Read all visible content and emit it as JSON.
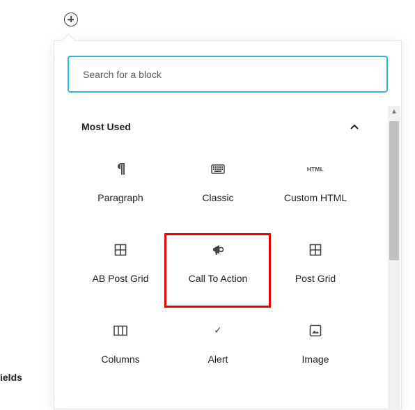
{
  "inserter": {
    "search_placeholder": "Search for a block",
    "panel_title": "Most Used"
  },
  "blocks": [
    {
      "label": "Paragraph",
      "icon": "paragraph-icon"
    },
    {
      "label": "Classic",
      "icon": "keyboard-icon"
    },
    {
      "label": "Custom HTML",
      "icon": "html-icon",
      "icon_text": "HTML"
    },
    {
      "label": "AB Post Grid",
      "icon": "grid-icon"
    },
    {
      "label": "Call To Action",
      "icon": "megaphone-icon"
    },
    {
      "label": "Post Grid",
      "icon": "grid-icon"
    },
    {
      "label": "Columns",
      "icon": "columns-icon"
    },
    {
      "label": "Alert",
      "icon": "checkmark-icon",
      "icon_text": "✓"
    },
    {
      "label": "Image",
      "icon": "image-icon"
    }
  ],
  "background": {
    "partial_label": "ields"
  },
  "colors": {
    "search_border": "#33b3db",
    "highlight": "#e50000"
  }
}
